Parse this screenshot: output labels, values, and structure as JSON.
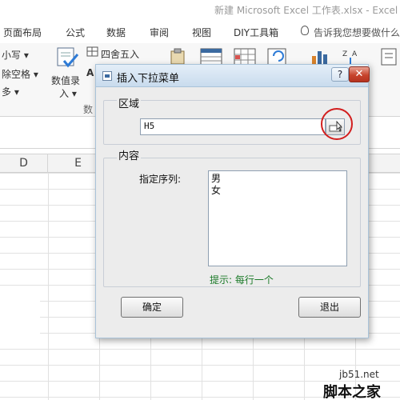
{
  "excel": {
    "window_title": "新建 Microsoft Excel 工作表.xlsx - Excel",
    "tabs": [
      "页面布局",
      "公式",
      "数据",
      "审阅",
      "视图",
      "DIY工具箱"
    ],
    "tell_me": "告诉我您想要做什么",
    "ribbon": {
      "lowercase": "小写 ▾",
      "remove_space": "除空格 ▾",
      "more": "多 ▾",
      "numeric_entry_1": "数值录",
      "numeric_entry_2": "入 ▾",
      "round": "四舍五入",
      "ribbon_a": "A",
      "group_partial": "数"
    },
    "columns": [
      "D",
      "E"
    ],
    "watermark_site": "jb51.net",
    "watermark_name": "脚本之家"
  },
  "dialog": {
    "title": "插入下拉菜单",
    "help_label": "?",
    "close_label": "✕",
    "range_group_label": "区域",
    "range_value": "H5",
    "content_group_label": "内容",
    "sequence_label": "指定序列:",
    "sequence_items": [
      "男",
      "女"
    ],
    "hint": "提示: 每行一个",
    "ok_label": "确定",
    "exit_label": "退出",
    "accent_red": "#d21e1e",
    "hint_color": "#1b7a28"
  }
}
